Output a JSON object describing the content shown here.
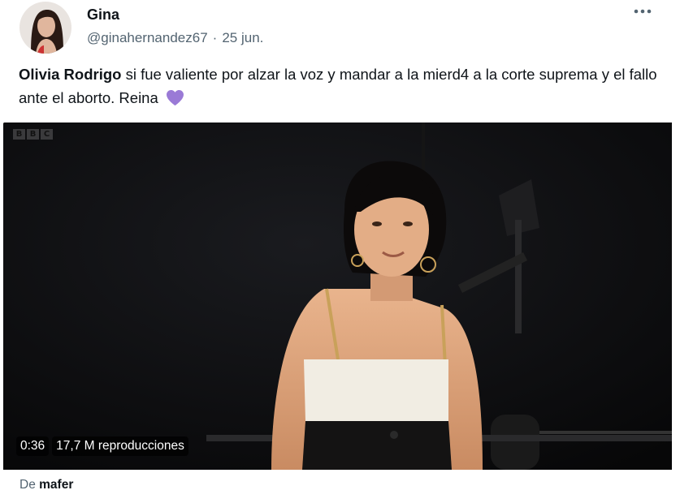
{
  "tweet": {
    "display_name": "Gina",
    "handle": "@ginahernandez67",
    "separator": "·",
    "date": "25 jun.",
    "mention": "Olivia Rodrigo",
    "body_text": " si fue valiente por alzar la voz y mandar a la mierd4 a la corte suprema y el fallo ante el aborto. Reina",
    "emoji": "purple-heart",
    "more_icon": "more-horizontal-icon"
  },
  "media": {
    "watermark": "BBC",
    "watermark_letters": [
      "B",
      "B",
      "C"
    ],
    "duration": "0:36",
    "views": "17,7 M reproducciones"
  },
  "source": {
    "prefix": "De",
    "name": "mafer"
  },
  "colors": {
    "text_primary": "#0f1419",
    "text_secondary": "#536471",
    "heart": "#9a7ad6",
    "video_bg": "#0b0b0c"
  }
}
